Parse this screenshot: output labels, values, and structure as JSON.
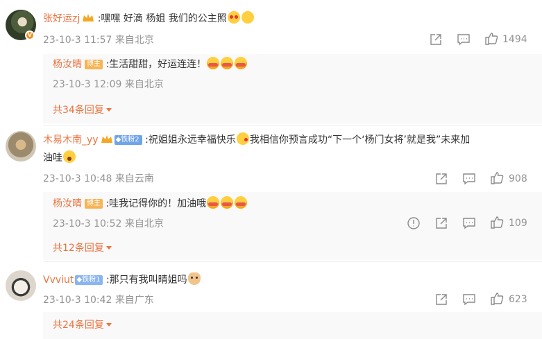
{
  "comments": [
    {
      "user": "张好运zj",
      "text_a": ":嘿嘿 好滴 杨姐 我们的公主照",
      "meta": "23-10-3 11:57 来自北京",
      "likes": "1494",
      "reply": {
        "user": "杨汝晴",
        "badge": "博主",
        "text": ":生活甜甜，好运连连！",
        "meta": "23-10-3 12:09 来自北京"
      },
      "more": "共34条回复"
    },
    {
      "user": "木易木南_yy",
      "fan_badge": "铁粉2",
      "text_a": ":祝姐姐永远幸福快乐",
      "text_b": "我相信你预言成功“下一个‘杨门女将’就是我”未来加",
      "text_c": "油哇",
      "meta": "23-10-3 10:48 来自云南",
      "likes": "908",
      "reply": {
        "user": "杨汝晴",
        "badge": "博主",
        "text": ":哇我记得你的！加油哦",
        "meta": "23-10-3 10:52 来自北京",
        "likes": "109"
      },
      "more": "共12条回复"
    },
    {
      "user": "Vvviut",
      "fan_badge": "铁粉1",
      "text_a": ":那只有我叫晴姐吗",
      "meta": "23-10-3 10:42 来自广东",
      "likes": "623",
      "more": "共24条回复"
    }
  ],
  "colors": {
    "username": "#eb7340",
    "meta": "#939393",
    "host_badge": "#f7b455",
    "fan_badge": "#6fa4e8"
  }
}
